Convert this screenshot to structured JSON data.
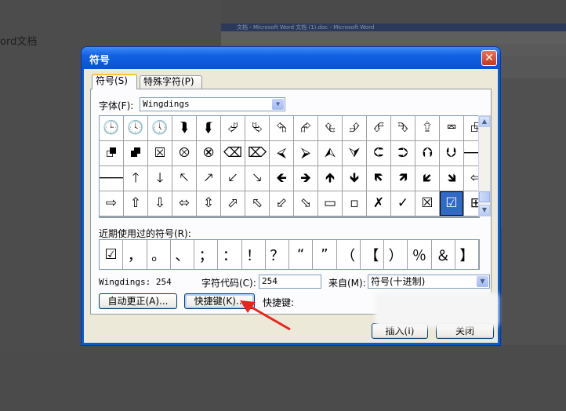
{
  "background": {
    "doc_fragment": "ord文档",
    "word_title_fragment": "文档 - Microsoft Word 文档 (1).doc - Microsoft Word"
  },
  "dialog": {
    "title": "符号",
    "close_glyph": "✕",
    "tabs": [
      {
        "label": "符号(S)",
        "active": true
      },
      {
        "label": "特殊字符(P)",
        "active": false
      }
    ],
    "font_label": "字体(F):",
    "font_value": "Wingdings",
    "symbols": [
      [
        "🕒",
        "🕓",
        "🕔",
        "⮯",
        "⮮",
        "⮰",
        "⮱",
        "⮲",
        "⮳",
        "⮴",
        "⮵",
        "⮶",
        "⮷",
        "⮸",
        "⮹",
        "⮺"
      ],
      [
        "⮻",
        "⮼",
        "⮽",
        "⮾",
        "⮿",
        "⌫",
        "⌦",
        "⮘",
        "⮚",
        "⮙",
        "⮛",
        "⮈",
        "⮊",
        "⮉",
        "⮋",
        "🡐"
      ],
      [
        "🡒",
        "🡑",
        "🡓",
        "🡔",
        "🡕",
        "🡗",
        "🡖",
        "🡸",
        "🡺",
        "🡹",
        "🡻",
        "🡼",
        "🡽",
        "🡿",
        "🡾",
        "⇦"
      ],
      [
        "⇨",
        "⇧",
        "⇩",
        "⬄",
        "⇳",
        "⬀",
        "⬁",
        "⬃",
        "⬂",
        "▭",
        "▫",
        "✗",
        "✓",
        "☒",
        "☑",
        "⊞"
      ]
    ],
    "selected_symbol": "☑",
    "recent_label": "近期使用过的符号(R):",
    "recent_symbols": [
      "☑",
      "，",
      "。",
      "、",
      "；",
      "：",
      "！",
      "？",
      "“",
      "”",
      "（",
      "【",
      "）",
      "％",
      "＆",
      "】"
    ],
    "char_info": "Wingdings: 254",
    "char_code_label": "字符代码(C):",
    "char_code_value": "254",
    "from_label": "来自(M):",
    "from_value": "符号(十进制)",
    "autocorrect_button": "自动更正(A)...",
    "shortcut_key_button": "快捷键(K)...",
    "shortcut_label": "快捷键:",
    "insert_button": "插入(I)",
    "close_button": "关闭"
  },
  "colors": {
    "titlebar": "#0a5bd3",
    "selected_cell": "#316ac5",
    "annotation_arrow": "#e8241c"
  }
}
